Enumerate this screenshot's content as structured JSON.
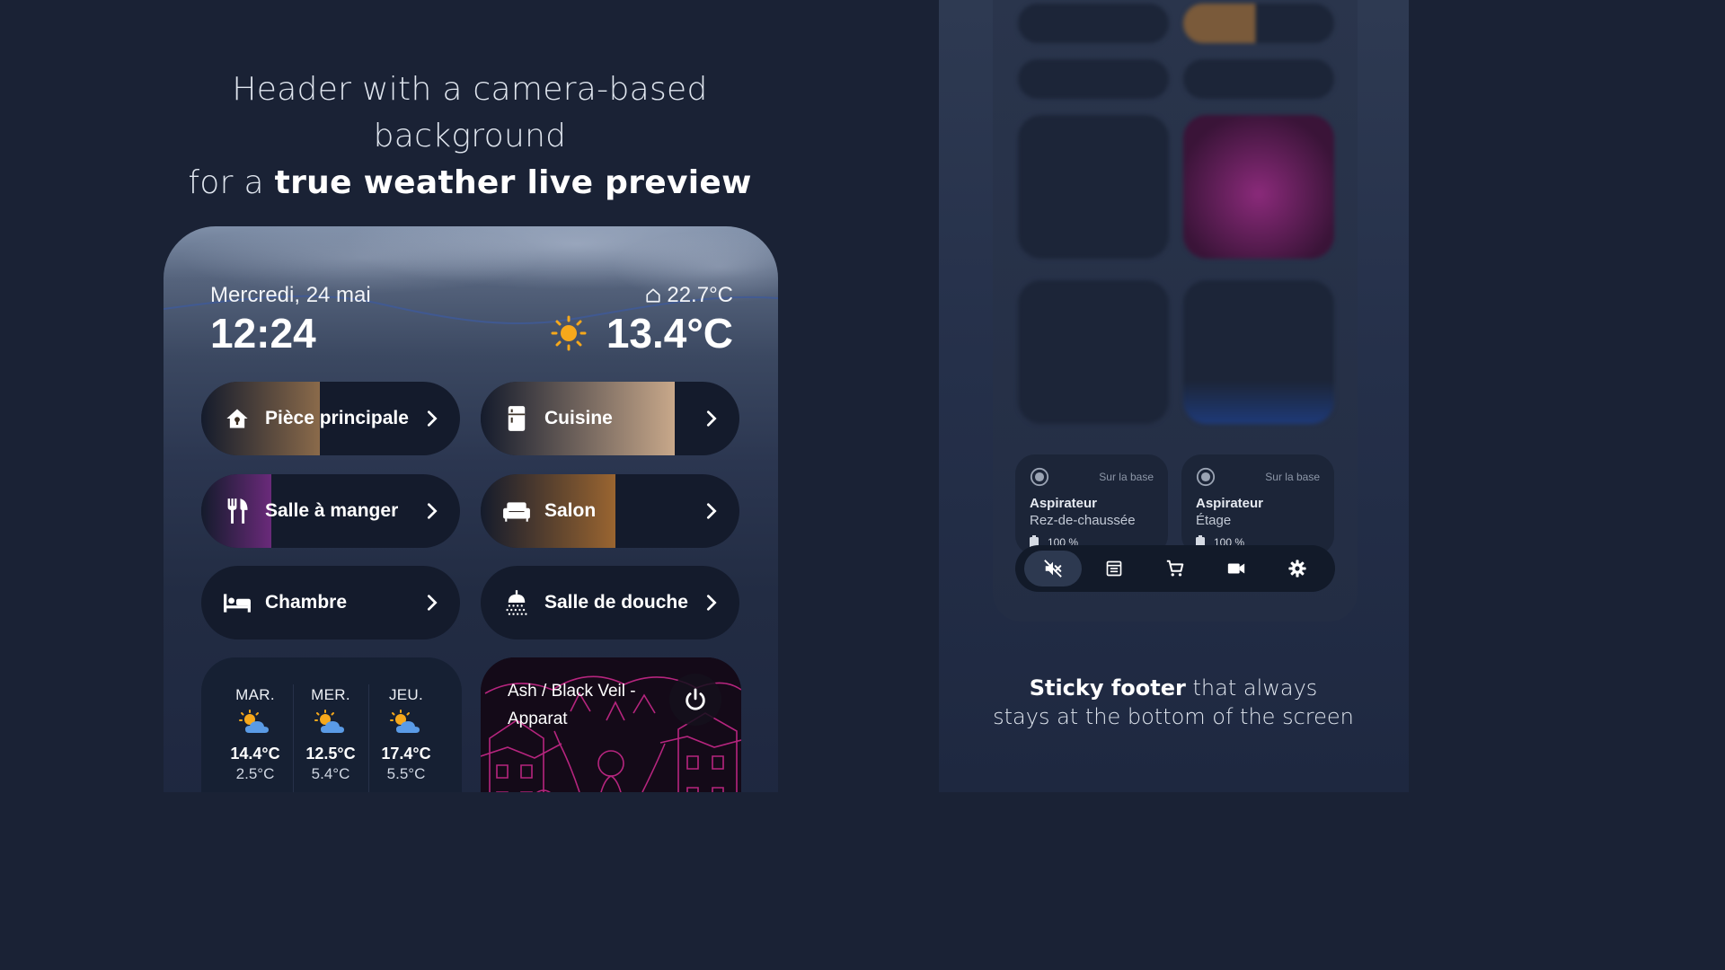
{
  "left_caption": {
    "line1": "Header with a camera-based background",
    "line2_prefix": "for a ",
    "line2_bold": "true weather live preview"
  },
  "right_caption": {
    "bold": "Sticky footer",
    "rest1": " that always",
    "line2": "stays at the bottom of the screen"
  },
  "header": {
    "date": "Mercredi, 24 mai",
    "time": "12:24",
    "indoor_temp": "22.7°C",
    "outdoor_temp": "13.4°C",
    "weather_icon": "sun-icon",
    "indoor_icon": "home-outline-icon"
  },
  "rooms": [
    {
      "label": "Pièce principale",
      "icon": "home-icon",
      "level": 0.46,
      "color": "#8a6a4a"
    },
    {
      "label": "Cuisine",
      "icon": "fridge-icon",
      "level": 0.75,
      "color": "#c8a88a"
    },
    {
      "label": "Salle à manger",
      "icon": "cutlery-icon",
      "level": 0.27,
      "color": "#6a2a7a"
    },
    {
      "label": "Salon",
      "icon": "sofa-icon",
      "level": 0.52,
      "color": "#9a6530"
    },
    {
      "label": "Chambre",
      "icon": "bed-icon",
      "level": 0,
      "color": "#141b2c"
    },
    {
      "label": "Salle de douche",
      "icon": "shower-icon",
      "level": 0,
      "color": "#141b2c"
    }
  ],
  "forecast": [
    {
      "day": "MAR.",
      "high": "14.4°C",
      "low": "2.5°C",
      "icon": "partly-cloudy-icon"
    },
    {
      "day": "MER.",
      "high": "12.5°C",
      "low": "5.4°C",
      "icon": "partly-cloudy-icon"
    },
    {
      "day": "JEU.",
      "high": "17.4°C",
      "low": "5.5°C",
      "icon": "partly-cloudy-icon"
    }
  ],
  "media": {
    "title": "Ash / Black Veil - Apparat",
    "power_icon": "power-icon"
  },
  "vacuums": [
    {
      "status": "Sur la base",
      "name": "Aspirateur",
      "floor": "Rez-de-chaussée",
      "battery": "100 %"
    },
    {
      "status": "Sur la base",
      "name": "Aspirateur",
      "floor": "Étage",
      "battery": "100 %"
    }
  ],
  "footer": [
    {
      "icon": "mute-icon",
      "active": true
    },
    {
      "icon": "list-icon",
      "active": false
    },
    {
      "icon": "cart-icon",
      "active": false
    },
    {
      "icon": "camera-icon",
      "active": false
    },
    {
      "icon": "gear-icon",
      "active": false
    }
  ]
}
